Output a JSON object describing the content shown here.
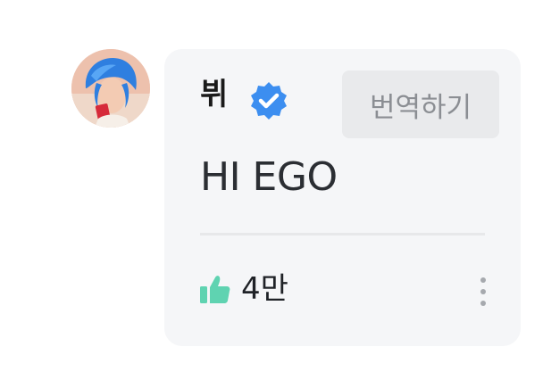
{
  "comment": {
    "author": "뷔",
    "text": "HI EGO",
    "translate_label": "번역하기",
    "like_count": "4만",
    "avatar_icon": "profile-avatar",
    "verified_icon": "verified-badge-icon",
    "like_icon": "thumbs-up-icon",
    "more_icon": "more-vertical-icon"
  },
  "colors": {
    "card_background": "#f5f6f8",
    "verified_badge": "#3c8ef0",
    "like_icon": "#5fd3b1",
    "translate_button": "#e9eaec",
    "translate_text": "#8b8e93",
    "divider": "#e7e8ea"
  }
}
